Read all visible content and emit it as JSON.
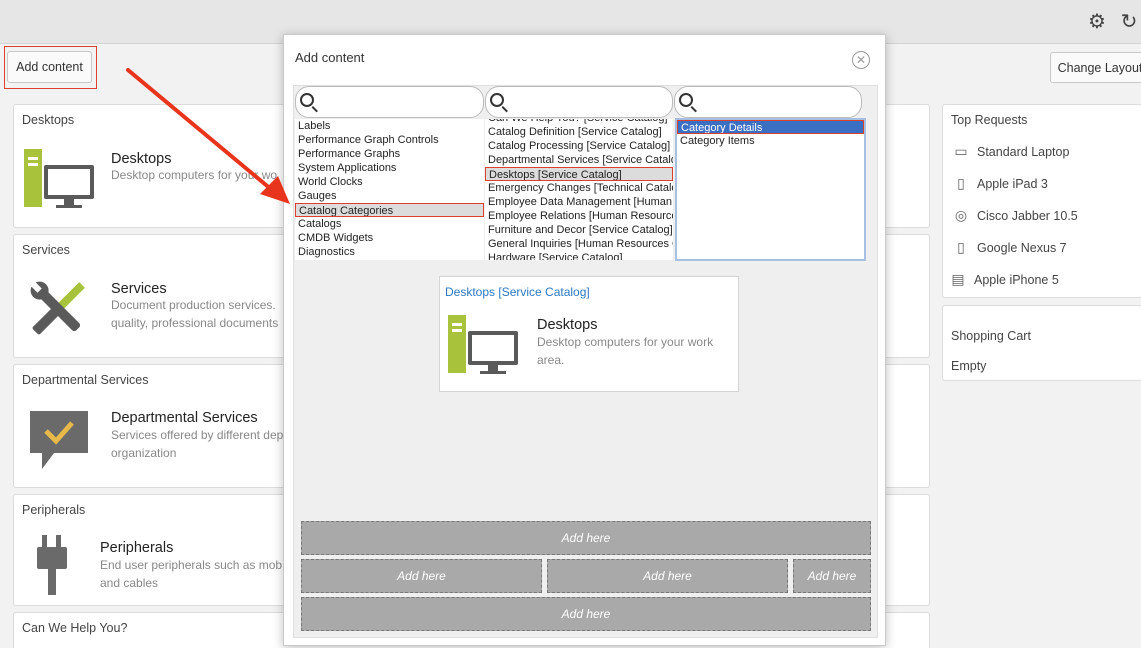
{
  "toolbar": {
    "add_content_label": "Add content",
    "change_layout_label": "Change Layout"
  },
  "cards": {
    "desktops": {
      "title": "Desktops",
      "item_title": "Desktops",
      "item_desc": "Desktop computers for your wo"
    },
    "services": {
      "title": "Services",
      "item_title": "Services",
      "item_desc_1": "Document production services.",
      "item_desc_2": "quality, professional documents"
    },
    "departmental": {
      "title": "Departmental Services",
      "item_title": "Departmental Services",
      "item_desc_1": "Services offered by different dep",
      "item_desc_2": "organization"
    },
    "peripherals": {
      "title": "Peripherals",
      "item_title": "Peripherals",
      "item_desc_1": "End user peripherals such as mob",
      "item_desc_2": "and cables"
    },
    "help": {
      "title": "Can We Help You?"
    }
  },
  "top_requests": {
    "title": "Top Requests",
    "items": [
      {
        "label": "Standard Laptop",
        "icon": "laptop-icon"
      },
      {
        "label": "Apple iPad 3",
        "icon": "tablet-icon"
      },
      {
        "label": "Cisco Jabber 10.5",
        "icon": "disc-icon"
      },
      {
        "label": "Google Nexus 7",
        "icon": "tablet-icon"
      },
      {
        "label": "Apple iPhone 5",
        "icon": "image-icon"
      }
    ]
  },
  "cart": {
    "title": "Shopping Cart",
    "status": "Empty"
  },
  "modal": {
    "title": "Add content",
    "col1": [
      "Labels",
      "Performance Graph Controls",
      "Performance Graphs",
      "System Applications",
      "World Clocks",
      "Gauges",
      "Catalog Categories",
      "Catalogs",
      "CMDB Widgets",
      "Diagnostics"
    ],
    "col2": [
      "Can We Help You? [Service Catalog]",
      "Catalog Definition [Service Catalog]",
      "Catalog Processing [Service Catalog]",
      "Departmental Services [Service Catalog]",
      "Desktops [Service Catalog]",
      "Emergency Changes [Technical Catalog]",
      "Employee Data Management [Human Resources]",
      "Employee Relations [Human Resources]",
      "Furniture and Decor [Service Catalog]",
      "General Inquiries [Human Resources Catalog]",
      "Hardware [Service Catalog]"
    ],
    "col3": [
      "Category Details",
      "Category Items"
    ],
    "preview": {
      "link": "Desktops [Service Catalog]",
      "title": "Desktops",
      "desc": "Desktop computers for your work area."
    },
    "drop_label": "Add here"
  },
  "colors": {
    "accent_red": "#d9412c",
    "selection_blue": "#3b6fc4",
    "link_blue": "#2a78c4",
    "icon_green": "#a8c23c"
  }
}
